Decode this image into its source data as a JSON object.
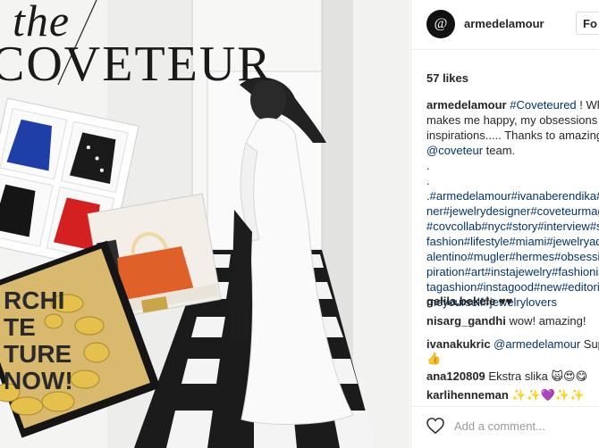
{
  "photo": {
    "brand_the": "the",
    "brand_name": "COVETEUR",
    "book_text": "RCHI TE TURE NOW!"
  },
  "post": {
    "username": "armedelamour",
    "follow_label": "Fo",
    "likes": "57 likes",
    "caption_lines": [
      {
        "user": "armedelamour",
        "text_before": " ",
        "tag": "#Coveteured",
        "text_after": " ! What"
      },
      {
        "text": "makes me happy, my obsessions a"
      },
      {
        "text": "inspirations..... Thanks to amazing"
      },
      {
        "tag": "@coveteur",
        "text_after": " team."
      },
      {
        "text": "."
      },
      {
        "text": "."
      },
      {
        "tag": ".#armedelamour#ivanaberendika#"
      },
      {
        "tag": "ner#jewelrydesigner#coveteurmag"
      },
      {
        "tag": "#covcollab#nyc#story#interview#s"
      },
      {
        "tag": "fashion#lifestyle#miami#jewelryad"
      },
      {
        "tag": "alentino#mugler#hermes#obsessi"
      },
      {
        "tag": "piration#art#instajewelry#fashionis"
      },
      {
        "tag": "tagashion#instagood#new#editori"
      },
      {
        "tag": "meyourself#jewelrylovers"
      }
    ],
    "comments": [
      {
        "user": "gelila.bekele",
        "text": " ♥♥"
      },
      {
        "user": "nisarg_gandhi",
        "text": " wow! amazing!"
      },
      {
        "user": "ivanakukric",
        "mention": " @armedelamour",
        "text": " Supe",
        "line2": "👍"
      },
      {
        "user": "ana120809",
        "text": " Ekstra slika 🙀😍😋"
      },
      {
        "user": "karlihenneman",
        "text": " ✨✨💜✨✨"
      }
    ],
    "add_comment_placeholder": "Add a comment..."
  }
}
